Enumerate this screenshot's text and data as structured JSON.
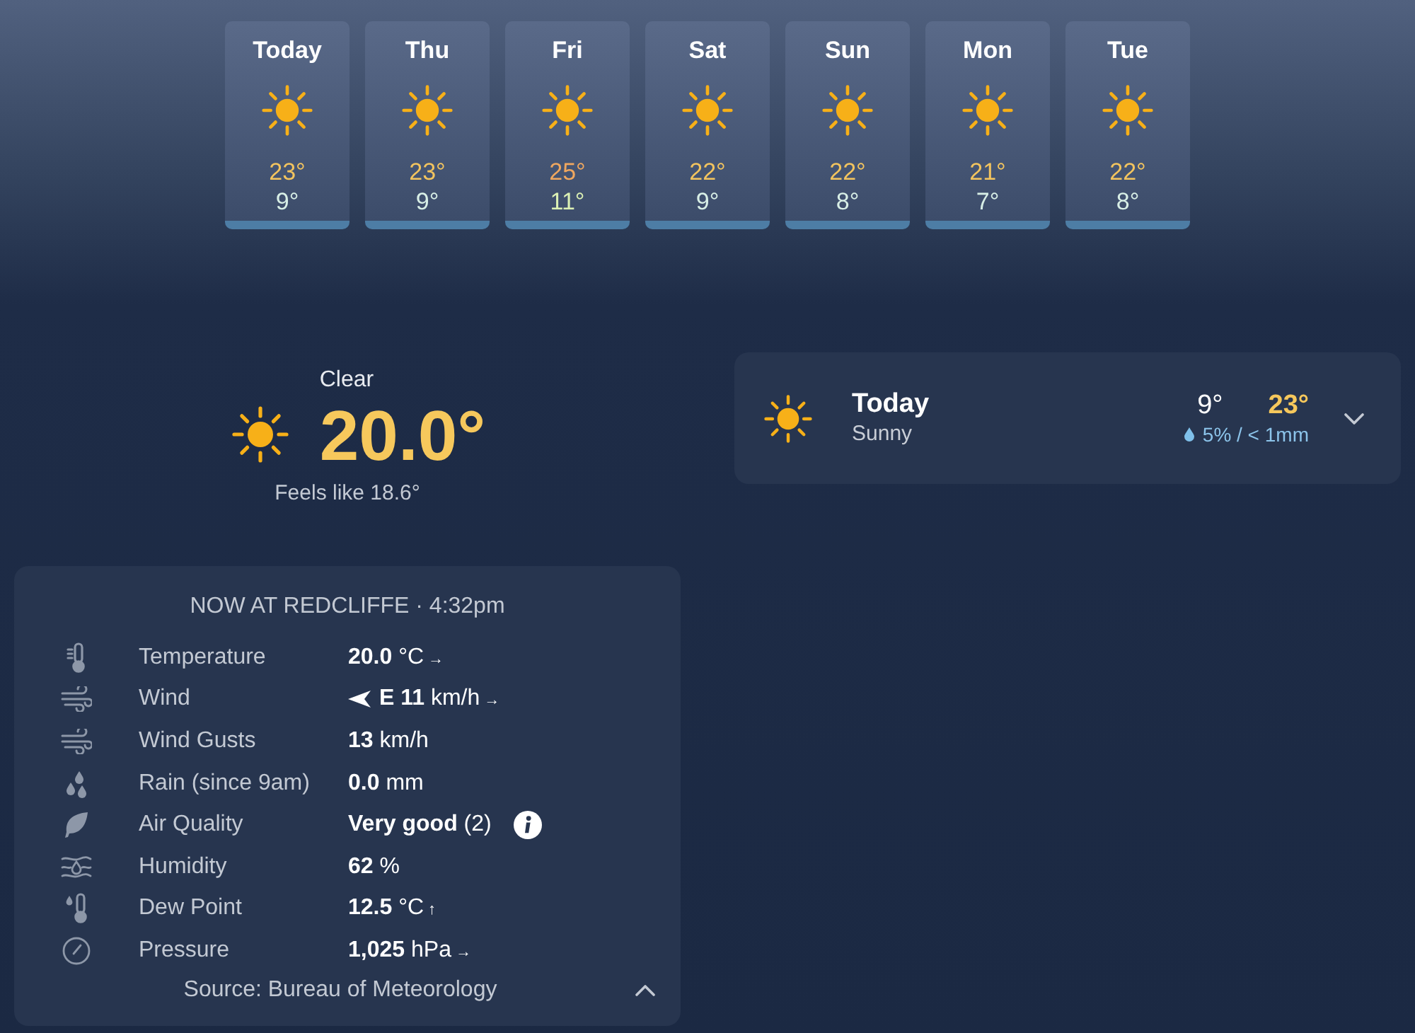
{
  "forecast": [
    {
      "day": "Today",
      "high": {
        "text": "23°",
        "color": "#f3c45e"
      },
      "low": {
        "text": "9°",
        "color": "#d8efe6"
      }
    },
    {
      "day": "Thu",
      "high": {
        "text": "23°",
        "color": "#f3c45e"
      },
      "low": {
        "text": "9°",
        "color": "#d8efe6"
      }
    },
    {
      "day": "Fri",
      "high": {
        "text": "25°",
        "color": "#efa75f"
      },
      "low": {
        "text": "11°",
        "color": "#dbf0b4"
      }
    },
    {
      "day": "Sat",
      "high": {
        "text": "22°",
        "color": "#f3c45e"
      },
      "low": {
        "text": "9°",
        "color": "#d8efe6"
      }
    },
    {
      "day": "Sun",
      "high": {
        "text": "22°",
        "color": "#f3c45e"
      },
      "low": {
        "text": "8°",
        "color": "#d8efe6"
      }
    },
    {
      "day": "Mon",
      "high": {
        "text": "21°",
        "color": "#f3c45e"
      },
      "low": {
        "text": "7°",
        "color": "#d8efe6"
      }
    },
    {
      "day": "Tue",
      "high": {
        "text": "22°",
        "color": "#f3c45e"
      },
      "low": {
        "text": "8°",
        "color": "#d8efe6"
      }
    }
  ],
  "current": {
    "condition": "Clear",
    "temperature": "20.0°",
    "feels_like": "Feels like 18.6°"
  },
  "today_card": {
    "title": "Today",
    "condition": "Sunny",
    "low": "9°",
    "high": "23°",
    "rain": "5% / < 1mm",
    "expanded": false
  },
  "observations": {
    "title": "NOW AT REDCLIFFE · 4:32pm",
    "rows": [
      {
        "kind": "temperature",
        "label": "Temperature",
        "value": "**20.0** °C",
        "trend": "→"
      },
      {
        "kind": "wind",
        "label": "Wind",
        "value": "**E 11** km/h",
        "trend": "→",
        "pointer": true
      },
      {
        "kind": "gusts",
        "label": "Wind Gusts",
        "value": "**13** km/h"
      },
      {
        "kind": "rain",
        "label": "Rain (since 9am)",
        "value": "**0.0** mm"
      },
      {
        "kind": "air",
        "label": "Air Quality",
        "value": "**Very good** (2)",
        "info": true
      },
      {
        "kind": "humidity",
        "label": "Humidity",
        "value": "**62** %"
      },
      {
        "kind": "dew",
        "label": "Dew Point",
        "value": "**12.5** °C",
        "trend": "↑"
      },
      {
        "kind": "pressure",
        "label": "Pressure",
        "value": "**1,025** hPa",
        "trend": "→"
      }
    ],
    "source": "Source: Bureau of Meteorology",
    "expanded": true
  }
}
